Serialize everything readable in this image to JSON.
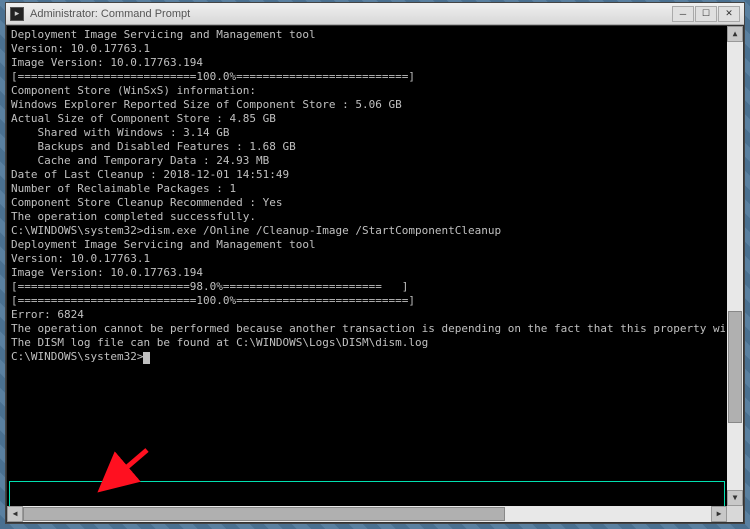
{
  "window": {
    "title": "Administrator: Command Prompt"
  },
  "console": {
    "lines": {
      "l1": "Deployment Image Servicing and Management tool",
      "l2": "Version: 10.0.17763.1",
      "l3": "",
      "l4": "Image Version: 10.0.17763.194",
      "l5": "",
      "l6": "[===========================100.0%==========================]",
      "l7": "",
      "l8": "Component Store (WinSxS) information:",
      "l9": "",
      "l10": "Windows Explorer Reported Size of Component Store : 5.06 GB",
      "l11": "",
      "l12": "Actual Size of Component Store : 4.85 GB",
      "l13": "",
      "l14": "    Shared with Windows : 3.14 GB",
      "l15": "    Backups and Disabled Features : 1.68 GB",
      "l16": "    Cache and Temporary Data : 24.93 MB",
      "l17": "",
      "l18": "Date of Last Cleanup : 2018-12-01 14:51:49",
      "l19": "",
      "l20": "Number of Reclaimable Packages : 1",
      "l21": "Component Store Cleanup Recommended : Yes",
      "l22": "",
      "l23": "The operation completed successfully.",
      "l24": "",
      "l25": "C:\\WINDOWS\\system32>dism.exe /Online /Cleanup-Image /StartComponentCleanup",
      "l26": "",
      "l27": "Deployment Image Servicing and Management tool",
      "l28": "Version: 10.0.17763.1",
      "l29": "",
      "l30": "Image Version: 10.0.17763.194",
      "l31": "",
      "l32": "[==========================98.0%========================   ]",
      "l33": "[===========================100.0%==========================]",
      "l34": "Error: 6824",
      "l35": "",
      "l36": "The operation cannot be performed because another transaction is depending on the fact that this property will not change.",
      "l37": "",
      "l38": "The DISM log file can be found at C:\\WINDOWS\\Logs\\DISM\\dism.log",
      "l39": "",
      "l40": "C:\\WINDOWS\\system32>"
    }
  },
  "annotations": {
    "highlight_color": "#00e0b0",
    "arrow_color": "#ff1020"
  }
}
